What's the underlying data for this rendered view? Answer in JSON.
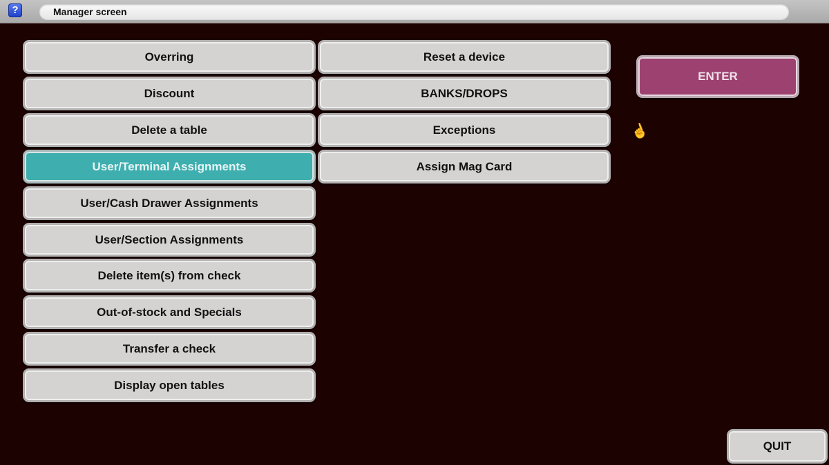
{
  "header": {
    "help_icon": "?",
    "title": "Manager screen"
  },
  "menu": {
    "left_column": [
      {
        "label": "Overring",
        "selected": false
      },
      {
        "label": "Discount",
        "selected": false
      },
      {
        "label": "Delete a table",
        "selected": false
      },
      {
        "label": "User/Terminal Assignments",
        "selected": true
      },
      {
        "label": "User/Cash Drawer Assignments",
        "selected": false
      },
      {
        "label": "User/Section Assignments",
        "selected": false
      },
      {
        "label": "Delete item(s) from check",
        "selected": false
      },
      {
        "label": "Out-of-stock and Specials",
        "selected": false
      },
      {
        "label": "Transfer a check",
        "selected": false
      },
      {
        "label": "Display open tables",
        "selected": false
      }
    ],
    "right_column": [
      {
        "label": "Reset a device"
      },
      {
        "label": "BANKS/DROPS"
      },
      {
        "label": "Exceptions"
      },
      {
        "label": "Assign Mag Card"
      }
    ]
  },
  "actions": {
    "enter_label": "ENTER",
    "quit_label": "QUIT"
  },
  "colors": {
    "background": "#1d0202",
    "selected": "#3eaeae",
    "enter": "#9d4270",
    "button": "#d5d2d2"
  },
  "cursor_icon": "hand-pointer"
}
